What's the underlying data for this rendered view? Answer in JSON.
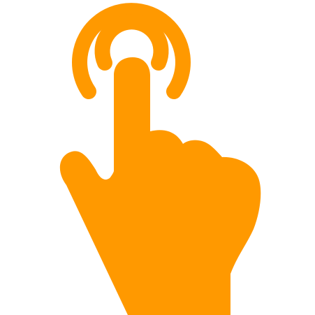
{
  "icon": {
    "name": "tap-gesture-icon",
    "color": "#FF9900",
    "background": "#FFFFFF"
  }
}
